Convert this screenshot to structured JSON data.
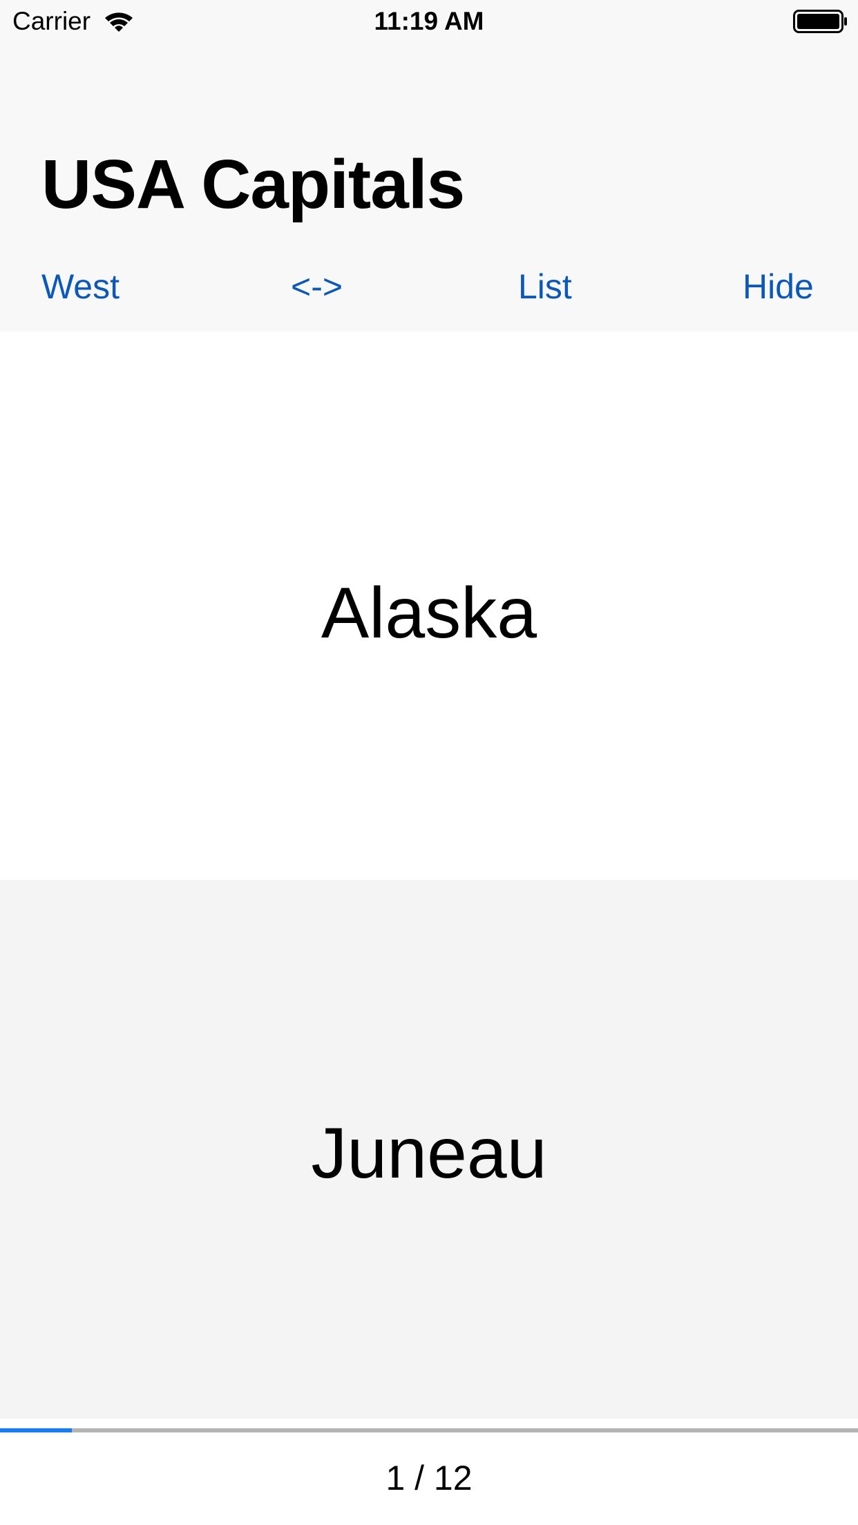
{
  "status_bar": {
    "carrier": "Carrier",
    "time": "11:19 AM",
    "wifi_icon": "wifi-icon",
    "battery_icon": "battery-icon"
  },
  "nav": {
    "title": "USA Capitals"
  },
  "toolbar": {
    "west_label": "West",
    "swap_label": "<->",
    "list_label": "List",
    "hide_label": "Hide"
  },
  "card": {
    "front_text": "Alaska",
    "back_text": "Juneau"
  },
  "progress": {
    "current": 1,
    "total": 12,
    "counter_text": "1 / 12"
  },
  "colors": {
    "accent": "#0b58b8",
    "progress_fill": "#1a7cf2",
    "progress_track": "#b4b4b4",
    "bar_background": "#f8f8f8",
    "answer_background": "#f4f4f4"
  }
}
